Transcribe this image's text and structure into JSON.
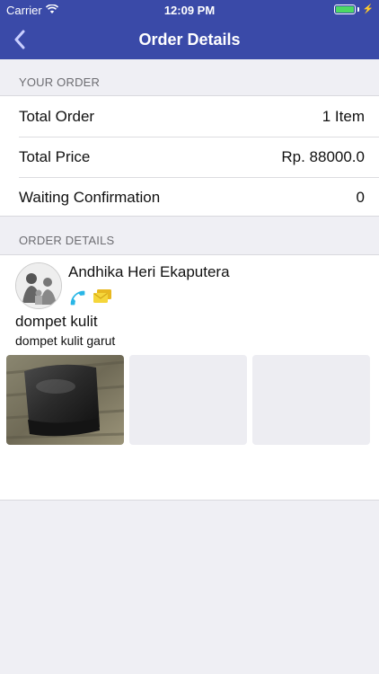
{
  "status_bar": {
    "carrier": "Carrier",
    "time": "12:09 PM",
    "battery_level": 1.0
  },
  "nav": {
    "title": "Order Details"
  },
  "your_order": {
    "header": "YOUR ORDER",
    "rows": [
      {
        "label": "Total Order",
        "value": "1 Item"
      },
      {
        "label": "Total Price",
        "value": "Rp. 88000.0"
      },
      {
        "label": "Waiting Confirmation",
        "value": "0"
      }
    ]
  },
  "order_details": {
    "header": "ORDER DETAILS",
    "seller_name": "Andhika Heri Ekaputera",
    "product_title": "dompet kulit",
    "product_description": "dompet kulit garut"
  },
  "colors": {
    "nav_bg": "#3a4aa8",
    "phone_icon": "#29b6e6",
    "message_icon": "#f2cc2c",
    "battery": "#4cd964"
  }
}
